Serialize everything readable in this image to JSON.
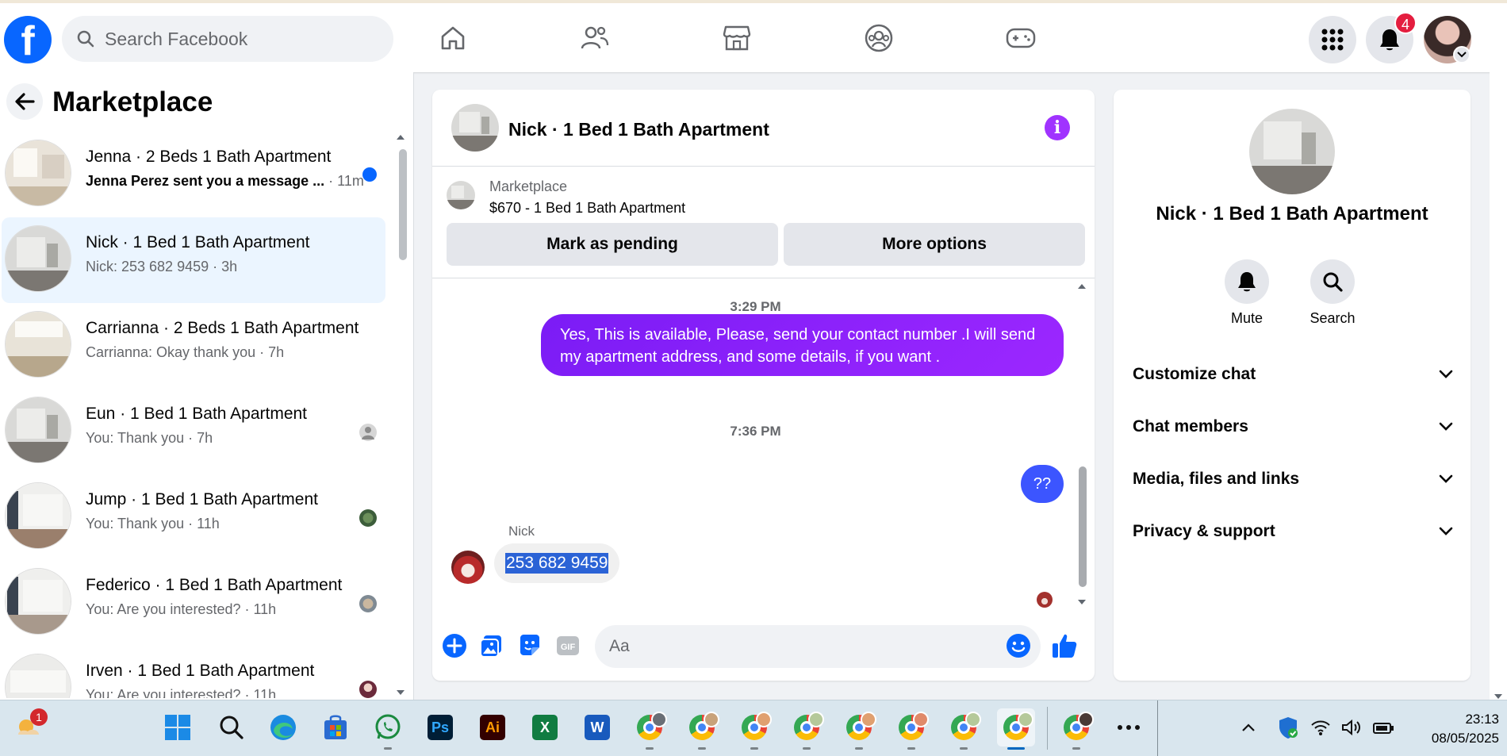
{
  "topbar": {
    "logo": "f",
    "search_placeholder": "Search Facebook",
    "nav_icons": [
      "home-icon",
      "friends-icon",
      "marketplace-icon",
      "groups-icon",
      "gaming-icon"
    ],
    "notification_count": "4"
  },
  "sidebar": {
    "title": "Marketplace",
    "conversations": [
      {
        "name": "Jenna · 2 Beds 1 Bath Apartment",
        "preview": "Jenna Perez sent you a message ...",
        "time": "· 11m",
        "unread": true
      },
      {
        "name": "Nick · 1 Bed 1 Bath Apartment",
        "preview": "Nick: 253 682 9459 · 3h",
        "active": true
      },
      {
        "name": "Carrianna · 2 Beds 1 Bath Apartment",
        "preview": "Carrianna: Okay thank you · 7h"
      },
      {
        "name": "Eun · 1 Bed 1 Bath Apartment",
        "preview": "You: Thank you · 7h"
      },
      {
        "name": "Jump · 1 Bed 1 Bath Apartment",
        "preview": "You: Thank you · 11h"
      },
      {
        "name": "Federico · 1 Bed 1 Bath Apartment",
        "preview": "You: Are you interested? · 11h"
      },
      {
        "name": "Irven · 1 Bed 1 Bath Apartment",
        "preview": "You: Are you interested? · 11h"
      }
    ]
  },
  "chat": {
    "title": "Nick · 1 Bed 1 Bath Apartment",
    "listing": {
      "label": "Marketplace",
      "price_title": "$670 - 1 Bed 1 Bath Apartment",
      "pending_button": "Mark as pending",
      "options_button": "More options"
    },
    "messages": {
      "time1": "3:29 PM",
      "out1": "Yes, This is  available, Please, send your contact number .I will send my apartment address, and some details, if you want .",
      "time2": "7:36 PM",
      "out2": "??",
      "sender": "Nick",
      "in1": "253 682 9459"
    },
    "composer_placeholder": "Aa"
  },
  "details": {
    "title": "Nick · 1 Bed 1 Bath Apartment",
    "mute_label": "Mute",
    "search_label": "Search",
    "sections": [
      "Customize chat",
      "Chat members",
      "Media, files and links",
      "Privacy & support"
    ]
  },
  "taskbar": {
    "weather_badge": "1",
    "time": "23:13",
    "date": "08/05/2025"
  },
  "colors": {
    "brand": "#0866ff",
    "accent_purple": "#9c27ff",
    "active_bg": "#ebf5ff",
    "badge_red": "#e41e3f"
  }
}
